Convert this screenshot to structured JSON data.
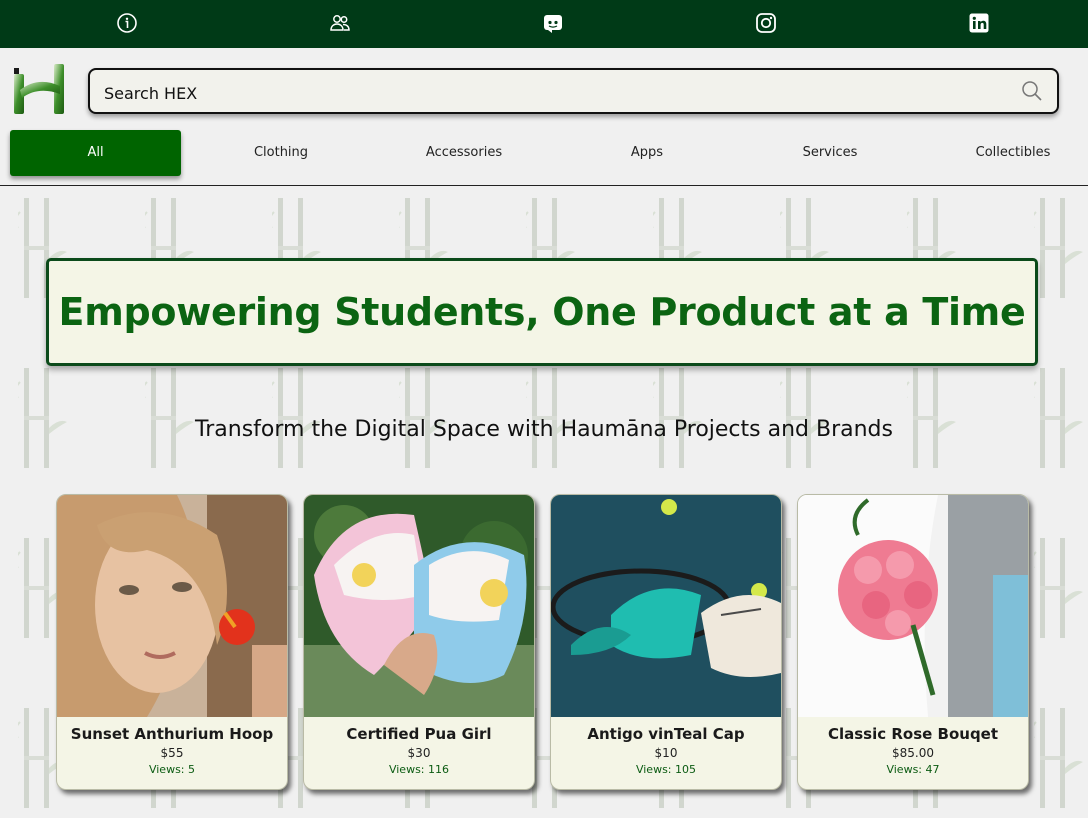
{
  "social": {
    "items": [
      {
        "icon": "info-icon"
      },
      {
        "icon": "people-icon"
      },
      {
        "icon": "discord-icon"
      },
      {
        "icon": "instagram-icon"
      },
      {
        "icon": "linkedin-icon"
      }
    ],
    "bg_color": "#003a17"
  },
  "search": {
    "placeholder": "Search HEX",
    "value": ""
  },
  "categories": [
    {
      "label": "All",
      "active": true
    },
    {
      "label": "Clothing"
    },
    {
      "label": "Accessories"
    },
    {
      "label": "Apps"
    },
    {
      "label": "Services"
    },
    {
      "label": "Collectibles"
    }
  ],
  "hero": {
    "title": "Empowering Students, One Product at a Time"
  },
  "subtitle": "Transform the Digital Space with Haumāna Projects and Brands",
  "products": [
    {
      "name": "Sunset Anthurium Hoop",
      "price": "$55",
      "views": "Views: 5"
    },
    {
      "name": "Certified Pua Girl",
      "price": "$30",
      "views": "Views: 116"
    },
    {
      "name": "Antigo vinTeal Cap",
      "price": "$10",
      "views": "Views: 105"
    },
    {
      "name": "Classic Rose Bouqet",
      "price": "$85.00",
      "views": "Views: 47"
    }
  ],
  "colors": {
    "accent": "#006400",
    "hero_text": "#0b6412",
    "card_bg": "#f4f5e6"
  }
}
